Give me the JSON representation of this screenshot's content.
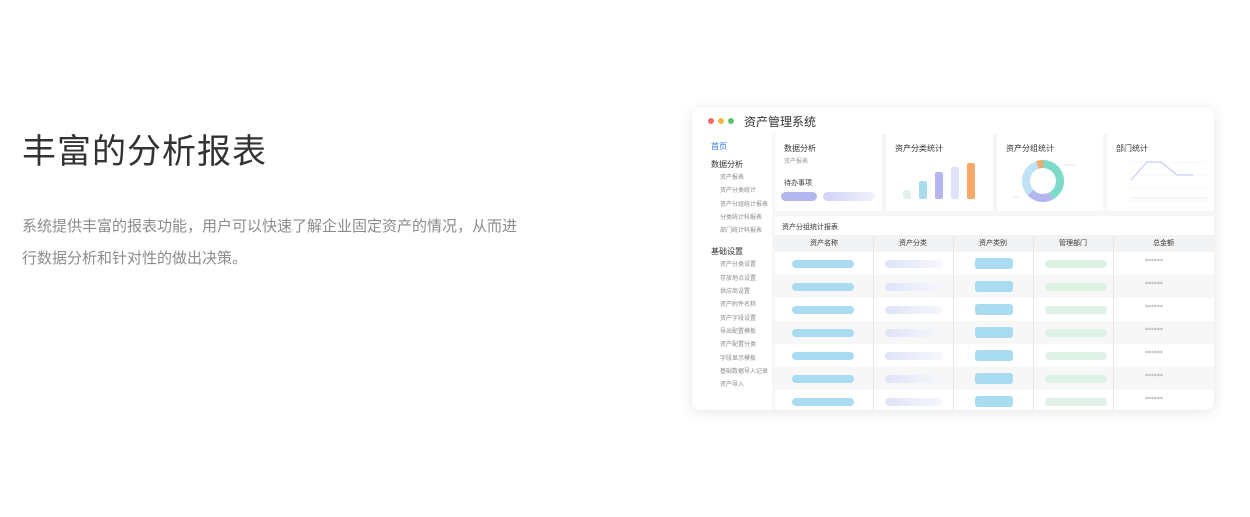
{
  "hero": {
    "title": "丰富的分析报表",
    "desc_line1": "系统提供丰富的报表功能，用户可以快速了解企业固定资产的情况，从而进",
    "desc_line2": "行数据分析和针对性的做出决策。"
  },
  "app": {
    "title": "资产管理系统",
    "window_dots": [
      "#f26b6b",
      "#f5b942",
      "#5cc46a"
    ]
  },
  "sidebar": {
    "home": "首页",
    "group1": "数据分析",
    "group1_items": [
      "资产报表",
      "资产分类统计",
      "资产分组统计报表",
      "分类统计科报表",
      "部门统计科报表"
    ],
    "group2": "基础设置",
    "group2_items": [
      "资产分类设置",
      "存放地点设置",
      "供应商设置",
      "资产附件名称",
      "资产字段设置",
      "导出配置模板",
      "资产配置分类",
      "字段显示模板",
      "基础数据导入记录",
      "资产导入"
    ]
  },
  "cards": {
    "data_analysis": {
      "title": "数据分析",
      "sub": "资产报表",
      "todo": "待办事项"
    },
    "category_stats": {
      "title": "资产分类统计"
    },
    "group_stats": {
      "title": "资产分组统计"
    },
    "dept_stats": {
      "title": "部门统计"
    }
  },
  "table": {
    "title": "资产分组统计报表",
    "columns": [
      "资产名称",
      "资产分类",
      "资产类别",
      "管理部门",
      "总金额"
    ],
    "masked_value": "******",
    "row_count": 7
  },
  "colors": {
    "accent_blue": "#2f7cf6",
    "bar_blue": "#a9dbf1",
    "bar_lavender": "#dfe3f7",
    "bar_green": "#dff2e6",
    "orange": "#f9a86a",
    "purple": "#b4b6f0",
    "teal": "#7ddbc8"
  }
}
